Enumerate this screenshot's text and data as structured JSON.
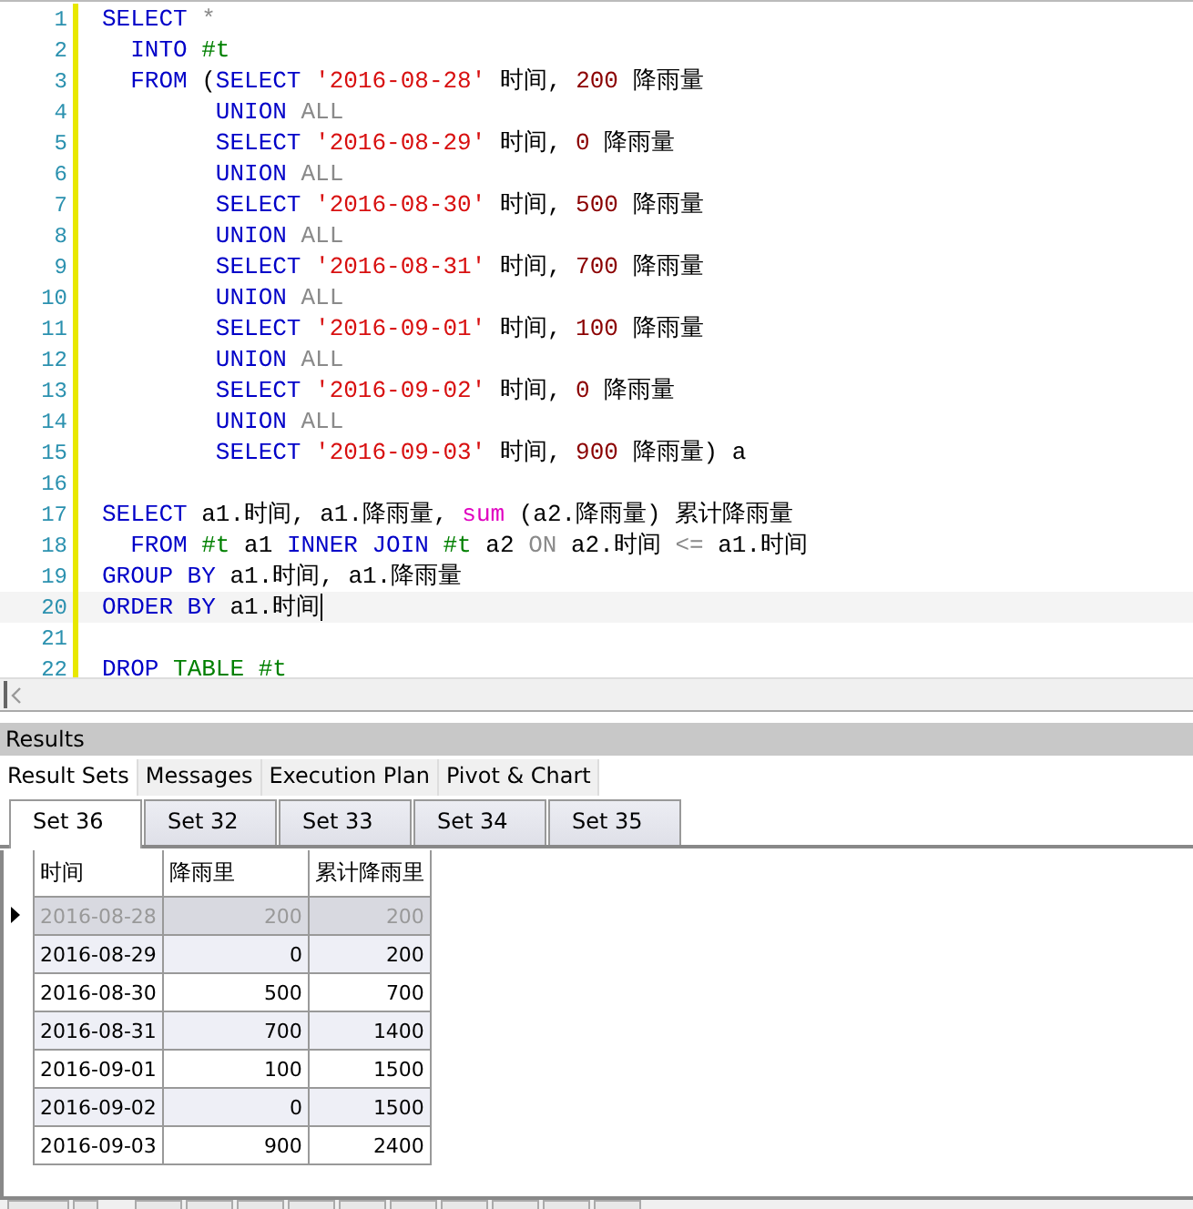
{
  "editor": {
    "lines": [
      {
        "number": "1",
        "current": false,
        "tokens": [
          {
            "kind": "kw",
            "text": "SELECT"
          },
          {
            "kind": "op",
            "text": " *"
          }
        ]
      },
      {
        "number": "2",
        "current": false,
        "tokens": [
          {
            "kind": "kw",
            "text": "  INTO"
          },
          {
            "kind": "tbl",
            "text": " #t"
          }
        ]
      },
      {
        "number": "3",
        "current": false,
        "tokens": [
          {
            "kind": "kw",
            "text": "  FROM"
          },
          {
            "kind": "plain",
            "text": " ("
          },
          {
            "kind": "kw",
            "text": "SELECT"
          },
          {
            "kind": "str",
            "text": " '2016-08-28'"
          },
          {
            "kind": "plain",
            "text": " 时间, "
          },
          {
            "kind": "num",
            "text": "200"
          },
          {
            "kind": "plain",
            "text": " 降雨量"
          }
        ]
      },
      {
        "number": "4",
        "current": false,
        "tokens": [
          {
            "kind": "kw",
            "text": "        UNION"
          },
          {
            "kind": "op",
            "text": " ALL"
          }
        ]
      },
      {
        "number": "5",
        "current": false,
        "tokens": [
          {
            "kind": "kw",
            "text": "        SELECT"
          },
          {
            "kind": "str",
            "text": " '2016-08-29'"
          },
          {
            "kind": "plain",
            "text": " 时间, "
          },
          {
            "kind": "num",
            "text": "0"
          },
          {
            "kind": "plain",
            "text": " 降雨量"
          }
        ]
      },
      {
        "number": "6",
        "current": false,
        "tokens": [
          {
            "kind": "kw",
            "text": "        UNION"
          },
          {
            "kind": "op",
            "text": " ALL"
          }
        ]
      },
      {
        "number": "7",
        "current": false,
        "tokens": [
          {
            "kind": "kw",
            "text": "        SELECT"
          },
          {
            "kind": "str",
            "text": " '2016-08-30'"
          },
          {
            "kind": "plain",
            "text": " 时间, "
          },
          {
            "kind": "num",
            "text": "500"
          },
          {
            "kind": "plain",
            "text": " 降雨量"
          }
        ]
      },
      {
        "number": "8",
        "current": false,
        "tokens": [
          {
            "kind": "kw",
            "text": "        UNION"
          },
          {
            "kind": "op",
            "text": " ALL"
          }
        ]
      },
      {
        "number": "9",
        "current": false,
        "tokens": [
          {
            "kind": "kw",
            "text": "        SELECT"
          },
          {
            "kind": "str",
            "text": " '2016-08-31'"
          },
          {
            "kind": "plain",
            "text": " 时间, "
          },
          {
            "kind": "num",
            "text": "700"
          },
          {
            "kind": "plain",
            "text": " 降雨量"
          }
        ]
      },
      {
        "number": "10",
        "current": false,
        "tokens": [
          {
            "kind": "kw",
            "text": "        UNION"
          },
          {
            "kind": "op",
            "text": " ALL"
          }
        ]
      },
      {
        "number": "11",
        "current": false,
        "tokens": [
          {
            "kind": "kw",
            "text": "        SELECT"
          },
          {
            "kind": "str",
            "text": " '2016-09-01'"
          },
          {
            "kind": "plain",
            "text": " 时间, "
          },
          {
            "kind": "num",
            "text": "100"
          },
          {
            "kind": "plain",
            "text": " 降雨量"
          }
        ]
      },
      {
        "number": "12",
        "current": false,
        "tokens": [
          {
            "kind": "kw",
            "text": "        UNION"
          },
          {
            "kind": "op",
            "text": " ALL"
          }
        ]
      },
      {
        "number": "13",
        "current": false,
        "tokens": [
          {
            "kind": "kw",
            "text": "        SELECT"
          },
          {
            "kind": "str",
            "text": " '2016-09-02'"
          },
          {
            "kind": "plain",
            "text": " 时间, "
          },
          {
            "kind": "num",
            "text": "0"
          },
          {
            "kind": "plain",
            "text": " 降雨量"
          }
        ]
      },
      {
        "number": "14",
        "current": false,
        "tokens": [
          {
            "kind": "kw",
            "text": "        UNION"
          },
          {
            "kind": "op",
            "text": " ALL"
          }
        ]
      },
      {
        "number": "15",
        "current": false,
        "tokens": [
          {
            "kind": "kw",
            "text": "        SELECT"
          },
          {
            "kind": "str",
            "text": " '2016-09-03'"
          },
          {
            "kind": "plain",
            "text": " 时间, "
          },
          {
            "kind": "num",
            "text": "900"
          },
          {
            "kind": "plain",
            "text": " 降雨量) a"
          }
        ]
      },
      {
        "number": "16",
        "current": false
      },
      {
        "number": "17",
        "current": false,
        "tokens": [
          {
            "kind": "kw",
            "text": "SELECT"
          },
          {
            "kind": "plain",
            "text": " a1.时间, a1.降雨量, "
          },
          {
            "kind": "fn",
            "text": "sum"
          },
          {
            "kind": "plain",
            "text": " (a2.降雨量) 累计降雨量"
          }
        ]
      },
      {
        "number": "18",
        "current": false,
        "tokens": [
          {
            "kind": "kw",
            "text": "  FROM"
          },
          {
            "kind": "tbl",
            "text": " #t"
          },
          {
            "kind": "plain",
            "text": " a1 "
          },
          {
            "kind": "kw",
            "text": "INNER JOIN"
          },
          {
            "kind": "tbl",
            "text": " #t"
          },
          {
            "kind": "plain",
            "text": " a2 "
          },
          {
            "kind": "op",
            "text": "ON"
          },
          {
            "kind": "plain",
            "text": " a2.时间 "
          },
          {
            "kind": "op",
            "text": "<="
          },
          {
            "kind": "plain",
            "text": " a1.时间"
          }
        ]
      },
      {
        "number": "19",
        "current": false,
        "tokens": [
          {
            "kind": "kw",
            "text": "GROUP BY"
          },
          {
            "kind": "plain",
            "text": " a1.时间, a1.降雨量"
          }
        ]
      },
      {
        "number": "20",
        "current": true,
        "tokens": [
          {
            "kind": "kw",
            "text": "ORDER BY"
          },
          {
            "kind": "plain",
            "text": " a1.时间"
          }
        ]
      },
      {
        "number": "21",
        "current": false
      },
      {
        "number": "22",
        "current": false,
        "tokens": [
          {
            "kind": "kw",
            "text": "DROP"
          },
          {
            "kind": "tbl",
            "text": " TABLE #t"
          }
        ]
      }
    ]
  },
  "results": {
    "title": "Results",
    "tabs": [
      {
        "label": "Result Sets",
        "selected": true
      },
      {
        "label": "Messages",
        "selected": false
      },
      {
        "label": "Execution Plan",
        "selected": false
      },
      {
        "label": "Pivot & Chart",
        "selected": false
      }
    ],
    "sets": [
      {
        "label": "Set 36",
        "selected": true
      },
      {
        "label": "Set 32",
        "selected": false
      },
      {
        "label": "Set 33",
        "selected": false
      },
      {
        "label": "Set 34",
        "selected": false
      },
      {
        "label": "Set 35",
        "selected": false
      }
    ],
    "table": {
      "columns": [
        "时间",
        "降雨里",
        "累计降雨里"
      ],
      "rows": [
        {
          "cells": [
            "2016-08-28",
            "200",
            "200"
          ],
          "selected": true
        },
        {
          "cells": [
            "2016-08-29",
            "0",
            "200"
          ],
          "selected": false
        },
        {
          "cells": [
            "2016-08-30",
            "500",
            "700"
          ],
          "selected": false
        },
        {
          "cells": [
            "2016-08-31",
            "700",
            "1400"
          ],
          "selected": false
        },
        {
          "cells": [
            "2016-09-01",
            "100",
            "1500"
          ],
          "selected": false
        },
        {
          "cells": [
            "2016-09-02",
            "0",
            "1500"
          ],
          "selected": false
        },
        {
          "cells": [
            "2016-09-03",
            "900",
            "2400"
          ],
          "selected": false
        }
      ]
    }
  }
}
